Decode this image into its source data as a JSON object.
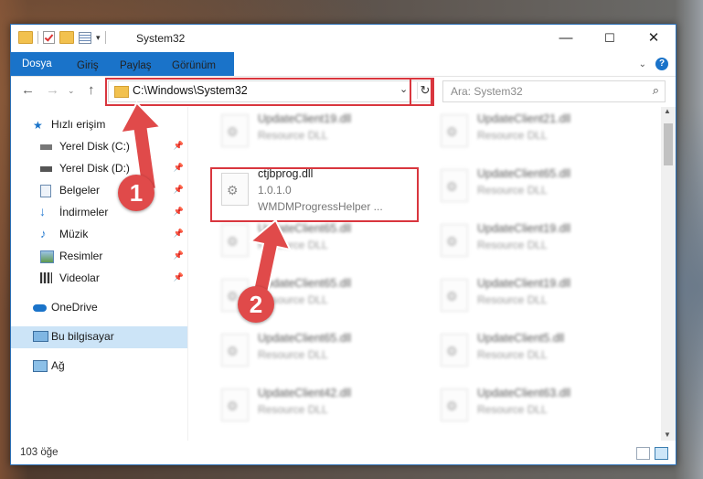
{
  "window": {
    "title": "System32",
    "controls": [
      "—",
      "☐",
      "✕"
    ]
  },
  "ribbon": {
    "tabs": [
      "Dosya",
      "Giriş",
      "Paylaş",
      "Görünüm"
    ]
  },
  "address": {
    "path": "C:\\Windows\\System32",
    "search_placeholder": "Ara: System32"
  },
  "sidebar": {
    "items": [
      {
        "label": "Hızlı erişim",
        "icon": "star-icon",
        "pinned": false
      },
      {
        "label": "Yerel Disk (C:)",
        "icon": "drive-icon",
        "pinned": true
      },
      {
        "label": "Yerel Disk (D:)",
        "icon": "drive-icon",
        "pinned": true
      },
      {
        "label": "Belgeler",
        "icon": "documents-icon",
        "pinned": true
      },
      {
        "label": "İndirmeler",
        "icon": "download-icon",
        "pinned": true
      },
      {
        "label": "Müzik",
        "icon": "music-icon",
        "pinned": true
      },
      {
        "label": "Resimler",
        "icon": "pictures-icon",
        "pinned": true
      },
      {
        "label": "Videolar",
        "icon": "videos-icon",
        "pinned": true
      },
      {
        "label": "OneDrive",
        "icon": "cloud-icon",
        "pinned": false
      },
      {
        "label": "Bu bilgisayar",
        "icon": "computer-icon",
        "pinned": false,
        "selected": true
      },
      {
        "label": "Ağ",
        "icon": "network-icon",
        "pinned": false
      }
    ]
  },
  "files": {
    "col1": [
      {
        "name": "UpdateClient19.dll",
        "sub": "Resource DLL"
      },
      {
        "name": "ctjbprog.dll",
        "sub": "1.0.1.0",
        "desc": "WMDMProgressHelper ...",
        "highlighted": true
      },
      {
        "name": "UpdateClient65.dll",
        "sub": "Resource DLL"
      },
      {
        "name": "UpdateClient65.dll",
        "sub": "Resource DLL"
      },
      {
        "name": "UpdateClient65.dll",
        "sub": "Resource DLL"
      },
      {
        "name": "UpdateClient42.dll",
        "sub": "Resource DLL"
      }
    ],
    "col2": [
      {
        "name": "UpdateClient21.dll",
        "sub": "Resource DLL"
      },
      {
        "name": "UpdateClient65.dll",
        "sub": "Resource DLL"
      },
      {
        "name": "UpdateClient19.dll",
        "sub": "Resource DLL"
      },
      {
        "name": "UpdateClient19.dll",
        "sub": "Resource DLL"
      },
      {
        "name": "UpdateClient5.dll",
        "sub": "Resource DLL"
      },
      {
        "name": "UpdateClient63.dll",
        "sub": "Resource DLL"
      }
    ]
  },
  "status": {
    "count": "103 öğe"
  },
  "annotations": {
    "badge1": "1",
    "badge2": "2",
    "color": "#e04a4a"
  }
}
